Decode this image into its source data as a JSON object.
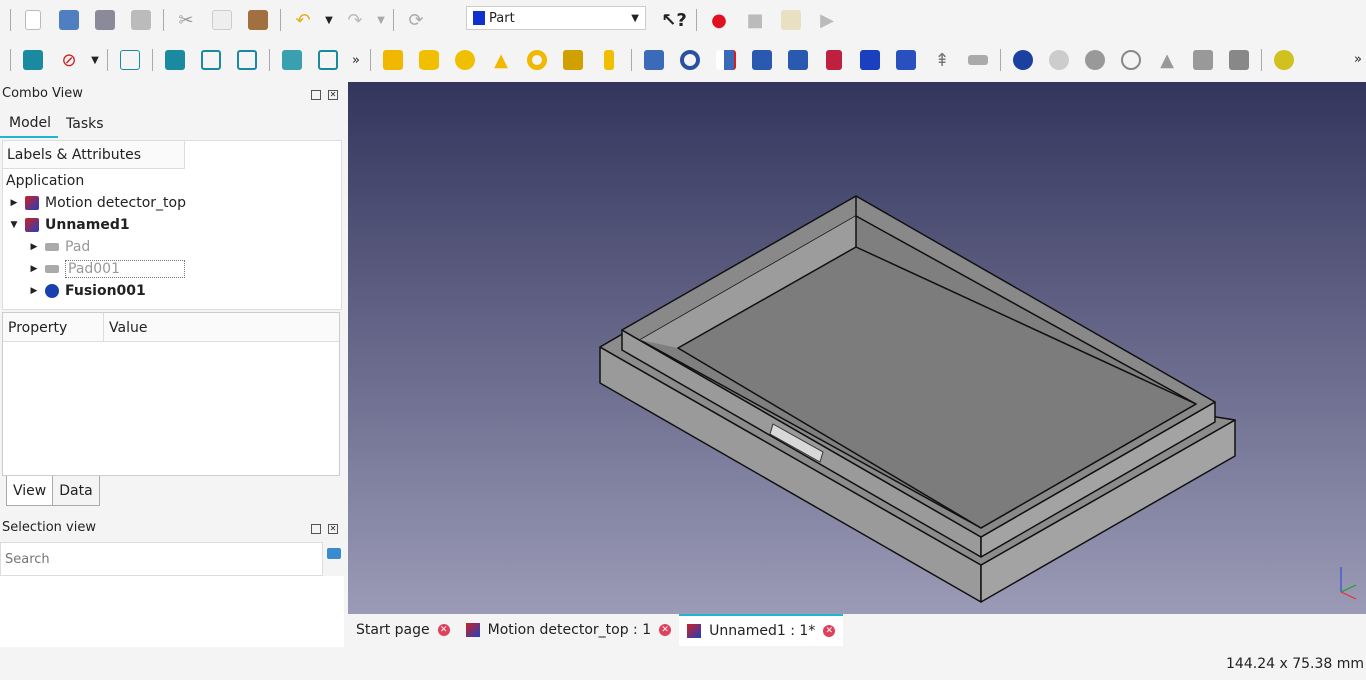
{
  "toolbar": {
    "workbench": "Part",
    "overflow": "»"
  },
  "combo": {
    "title": "Combo View",
    "tabs": [
      "Model",
      "Tasks"
    ],
    "labels_header": "Labels & Attributes",
    "tree": [
      {
        "label": "Application"
      },
      {
        "label": "Motion detector_top"
      },
      {
        "label": "Unnamed1"
      },
      {
        "label": "Pad"
      },
      {
        "label": "Pad001"
      },
      {
        "label": "Fusion001"
      }
    ],
    "prop_headers": [
      "Property",
      "Value"
    ],
    "bottom_tabs": [
      "View",
      "Data"
    ]
  },
  "selection": {
    "title": "Selection view",
    "placeholder": "Search"
  },
  "doc_tabs": [
    "Start page",
    "Motion detector_top : 1",
    "Unnamed1 : 1*"
  ],
  "status": {
    "dimensions": "144.24 x 75.38 mm"
  },
  "colors": {
    "accent": "#1eb6d0",
    "viewport_top": "#33355d",
    "viewport_bottom": "#9b9bb7"
  }
}
